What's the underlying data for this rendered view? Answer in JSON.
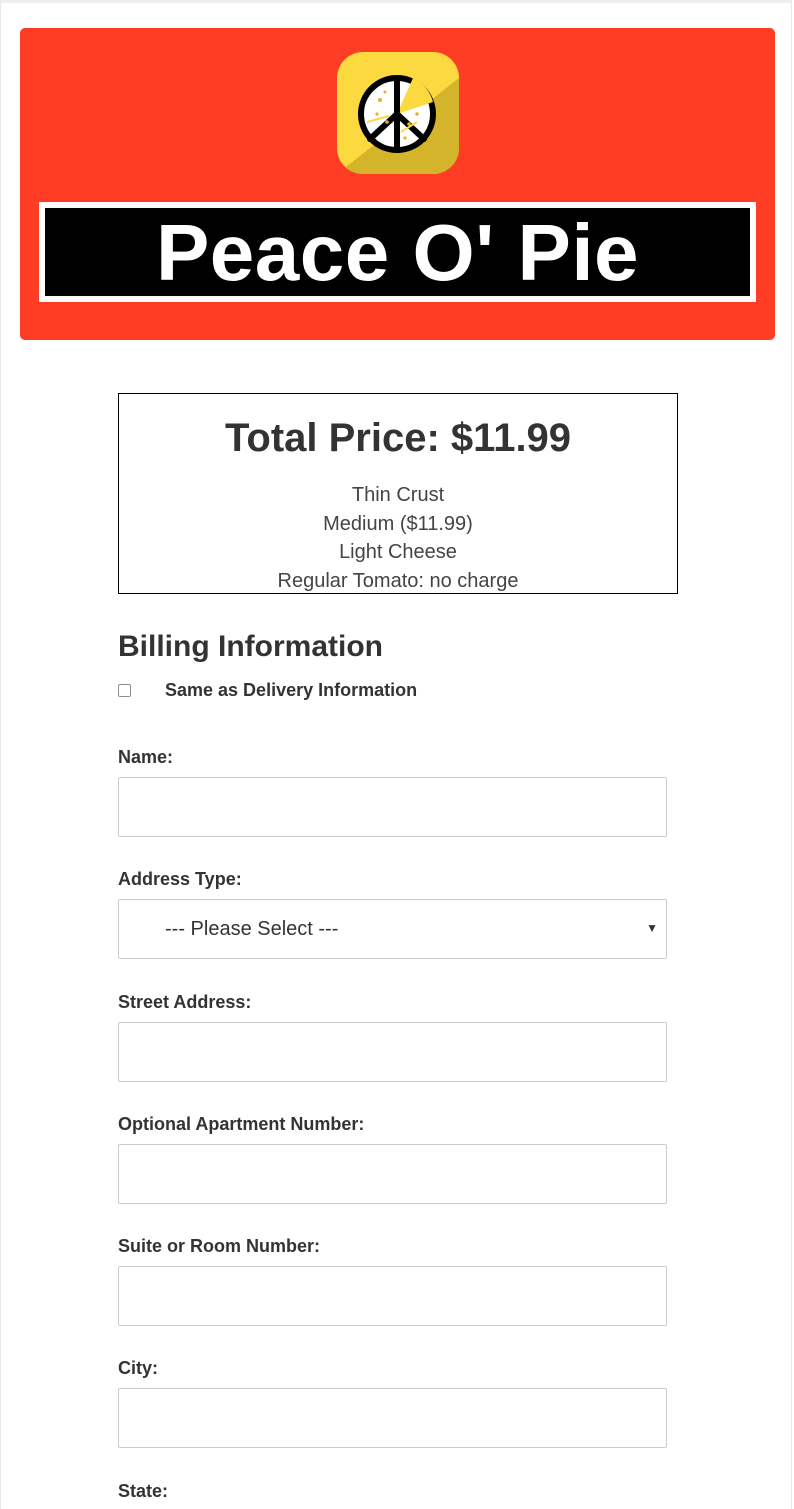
{
  "header": {
    "logo_icon": "peace-pizza-logo-icon",
    "brand_name": "Peace O' Pie",
    "colors": {
      "banner": "#ff3d24",
      "logo_light": "#fbd93f",
      "logo_dark": "#d4b42a",
      "brand_box": "#000000"
    }
  },
  "summary": {
    "total_price": "Total Price: $11.99",
    "items": [
      "Thin Crust",
      "Medium ($11.99)",
      "Light Cheese",
      "Regular Tomato: no charge"
    ]
  },
  "billing": {
    "title": "Billing Information",
    "same_as_delivery": {
      "label": "Same as Delivery Information",
      "checked": false
    },
    "fields": {
      "name": {
        "label": "Name:",
        "value": ""
      },
      "address_type": {
        "label": "Address Type:",
        "selected": "--- Please Select ---"
      },
      "street_address": {
        "label": "Street Address:",
        "value": ""
      },
      "apartment": {
        "label": "Optional Apartment Number:",
        "value": ""
      },
      "suite": {
        "label": "Suite or Room Number:",
        "value": ""
      },
      "city": {
        "label": "City:",
        "value": ""
      },
      "state": {
        "label": "State:"
      }
    }
  }
}
